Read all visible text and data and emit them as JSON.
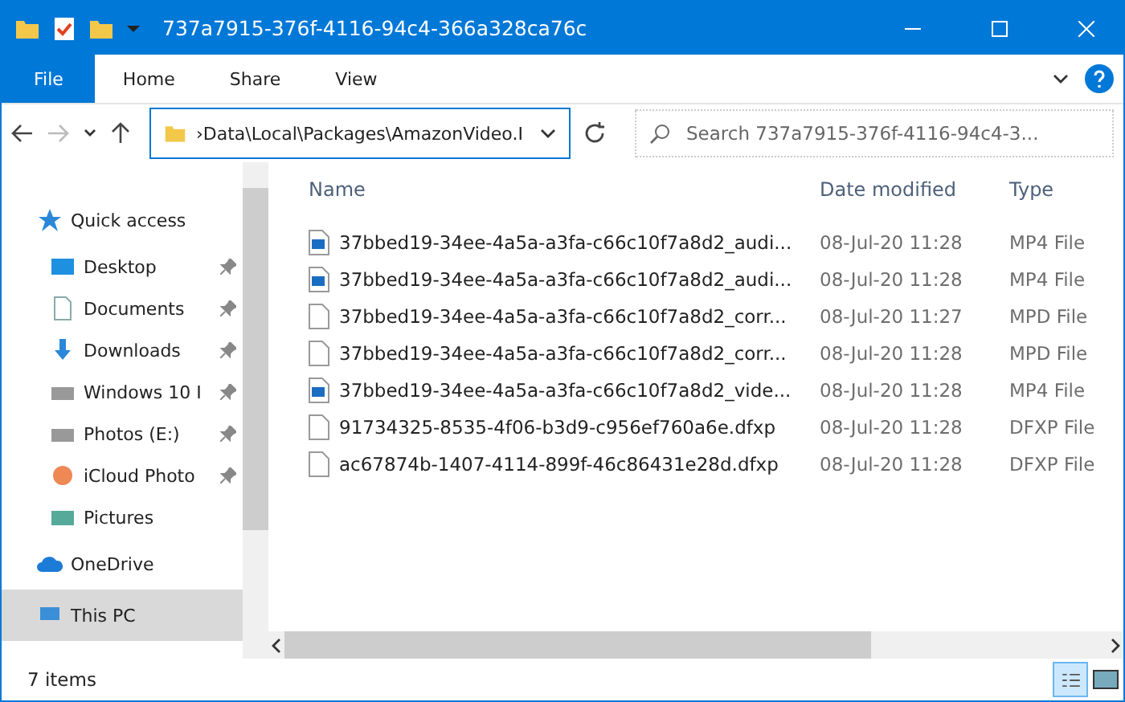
{
  "window": {
    "title": "737a7915-376f-4116-94c4-366a328ca76c"
  },
  "ribbon_tabs": [
    {
      "label": "File",
      "kind": "file"
    },
    {
      "label": "Home",
      "kind": "tab"
    },
    {
      "label": "Share",
      "kind": "tab"
    },
    {
      "label": "View",
      "kind": "tab"
    }
  ],
  "address": {
    "value": "›Data\\Local\\Packages\\AmazonVideo.I"
  },
  "search": {
    "placeholder": "Search 737a7915-376f-4116-94c4-3..."
  },
  "sidebar": {
    "items": [
      {
        "label": "Quick access",
        "kind": "section",
        "pinned": false,
        "selected": false
      },
      {
        "label": "Desktop",
        "kind": "item",
        "pinned": true,
        "selected": false
      },
      {
        "label": "Documents",
        "kind": "item",
        "pinned": true,
        "selected": false
      },
      {
        "label": "Downloads",
        "kind": "item",
        "pinned": true,
        "selected": false
      },
      {
        "label": "Windows 10 I",
        "kind": "item",
        "pinned": true,
        "selected": false
      },
      {
        "label": "Photos (E:)",
        "kind": "item",
        "pinned": true,
        "selected": false
      },
      {
        "label": "iCloud Photo",
        "kind": "item",
        "pinned": true,
        "selected": false
      },
      {
        "label": "Pictures",
        "kind": "item",
        "pinned": false,
        "selected": false
      },
      {
        "label": "OneDrive",
        "kind": "section",
        "pinned": false,
        "selected": false
      },
      {
        "label": "This PC",
        "kind": "section",
        "pinned": false,
        "selected": true
      }
    ]
  },
  "table": {
    "columns": [
      "Name",
      "Date modified",
      "Type"
    ],
    "rows": [
      {
        "name": "37bbed19-34ee-4a5a-a3fa-c66c10f7a8d2_audi...",
        "date": "08-Jul-20 11:28",
        "type": "MP4 File",
        "kind": "video"
      },
      {
        "name": "37bbed19-34ee-4a5a-a3fa-c66c10f7a8d2_audi...",
        "date": "08-Jul-20 11:28",
        "type": "MP4 File",
        "kind": "video"
      },
      {
        "name": "37bbed19-34ee-4a5a-a3fa-c66c10f7a8d2_corr...",
        "date": "08-Jul-20 11:27",
        "type": "MPD File",
        "kind": "plain"
      },
      {
        "name": "37bbed19-34ee-4a5a-a3fa-c66c10f7a8d2_corr...",
        "date": "08-Jul-20 11:28",
        "type": "MPD File",
        "kind": "plain"
      },
      {
        "name": "37bbed19-34ee-4a5a-a3fa-c66c10f7a8d2_vide...",
        "date": "08-Jul-20 11:28",
        "type": "MP4 File",
        "kind": "video"
      },
      {
        "name": "91734325-8535-4f06-b3d9-c956ef760a6e.dfxp",
        "date": "08-Jul-20 11:28",
        "type": "DFXP File",
        "kind": "plain"
      },
      {
        "name": "ac67874b-1407-4114-899f-46c86431e28d.dfxp",
        "date": "08-Jul-20 11:28",
        "type": "DFXP File",
        "kind": "plain"
      }
    ]
  },
  "view_buttons": [
    {
      "kind": "details",
      "selected": true
    },
    {
      "kind": "large",
      "selected": false
    }
  ],
  "status_bar": {
    "text": "7 items"
  }
}
